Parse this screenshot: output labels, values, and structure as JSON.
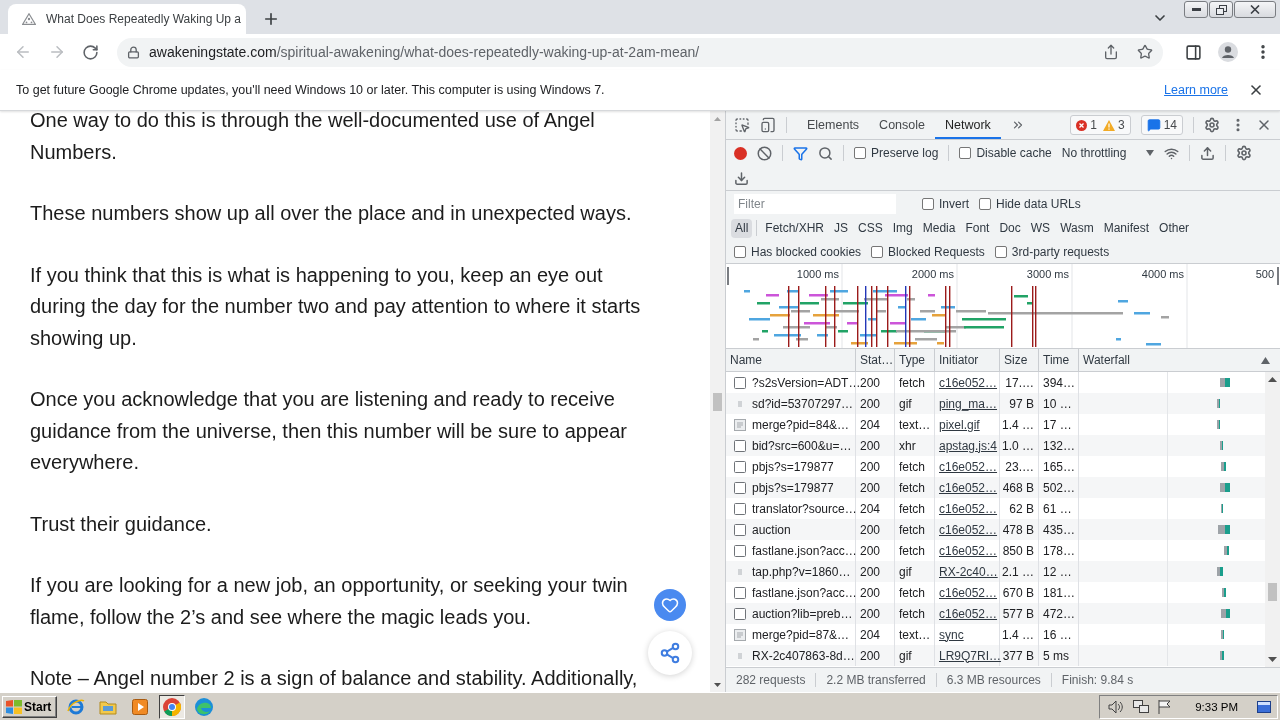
{
  "browser": {
    "tabs": [
      {
        "title": "What Does Repeatedly Waking Up a",
        "selected": true
      }
    ],
    "back": {
      "disabled": true
    },
    "forward": {
      "disabled": true
    },
    "address": {
      "domain": "awakeningstate.com",
      "path": "/spiritual-awakening/what-does-repeatedly-waking-up-at-2am-mean/"
    }
  },
  "infobar": {
    "message": "To get future Google Chrome updates, you'll need Windows 10 or later. This computer is using Windows 7.",
    "link": "Learn more"
  },
  "article": {
    "paragraphs": [
      "One way to do this is through the well-documented use of Angel Numbers.",
      "These numbers show up all over the place and in unexpected ways.",
      "If you think that this is what is happening to you, keep an eye out during the day for the number two and pay attention to where it starts showing up.",
      "Once you acknowledge that you are listening and ready to receive guidance from the universe, then this number will be sure to appear everywhere.",
      "Trust their guidance.",
      "If you are looking for a new job, an opportunity, or seeking your twin flame, follow the 2’s and see where the magic leads you.",
      "Note – Angel number 2 is a sign of balance and stability. Additionally,"
    ]
  },
  "devtools": {
    "tabs": [
      {
        "label": "Elements",
        "selected": false
      },
      {
        "label": "Console",
        "selected": false
      },
      {
        "label": "Network",
        "selected": true
      }
    ],
    "issues": {
      "errors": "1",
      "warnings": "3",
      "messages": "14"
    },
    "recording": true,
    "toolbar_options": [
      {
        "label": "Preserve log",
        "checked": false
      },
      {
        "label": "Disable cache",
        "checked": false
      }
    ],
    "throttling": "No throttling",
    "filter": {
      "placeholder": "Filter"
    },
    "filter_options": [
      {
        "label": "Invert",
        "checked": false
      },
      {
        "label": "Hide data URLs",
        "checked": false
      }
    ],
    "type_filters": [
      {
        "label": "All",
        "selected": true
      },
      {
        "label": "Fetch/XHR",
        "selected": false
      },
      {
        "label": "JS",
        "selected": false
      },
      {
        "label": "CSS",
        "selected": false
      },
      {
        "label": "Img",
        "selected": false
      },
      {
        "label": "Media",
        "selected": false
      },
      {
        "label": "Font",
        "selected": false
      },
      {
        "label": "Doc",
        "selected": false
      },
      {
        "label": "WS",
        "selected": false
      },
      {
        "label": "Wasm",
        "selected": false
      },
      {
        "label": "Manifest",
        "selected": false
      },
      {
        "label": "Other",
        "selected": false
      }
    ],
    "request_options": [
      {
        "label": "Has blocked cookies",
        "checked": false
      },
      {
        "label": "Blocked Requests",
        "checked": false
      },
      {
        "label": "3rd-party requests",
        "checked": false
      }
    ],
    "overview_ticks": [
      "1000 ms",
      "2000 ms",
      "3000 ms",
      "4000 ms",
      "500"
    ],
    "columns": [
      "Name",
      "Stat…",
      "Type",
      "Initiator",
      "Size",
      "Time",
      "Waterfall"
    ],
    "requests": [
      {
        "kind": "file",
        "name": "?s2sVersion=ADT…",
        "status": "200",
        "type": "fetch",
        "initiator": "c16e052…",
        "size": "17.…",
        "time": "394…"
      },
      {
        "kind": "image",
        "name": "sd?id=53707297…",
        "status": "200",
        "type": "gif",
        "initiator": "ping_ma…",
        "size": "97 B",
        "time": "10 …"
      },
      {
        "kind": "document",
        "name": "merge?pid=84&…",
        "status": "204",
        "type": "text…",
        "initiator": "pixel.gif",
        "size": "1.4 …",
        "time": "17 …"
      },
      {
        "kind": "file",
        "name": "bid?src=600&u=…",
        "status": "200",
        "type": "xhr",
        "initiator": "apstag.js:4",
        "size": "1.0 …",
        "time": "132…"
      },
      {
        "kind": "file",
        "name": "pbjs?s=179877",
        "status": "200",
        "type": "fetch",
        "initiator": "c16e052…",
        "size": "23.…",
        "time": "165…"
      },
      {
        "kind": "file",
        "name": "pbjs?s=179877",
        "status": "200",
        "type": "fetch",
        "initiator": "c16e052…",
        "size": "468 B",
        "time": "502…"
      },
      {
        "kind": "file",
        "name": "translator?source…",
        "status": "204",
        "type": "fetch",
        "initiator": "c16e052…",
        "size": "62 B",
        "time": "61 …"
      },
      {
        "kind": "file",
        "name": "auction",
        "status": "200",
        "type": "fetch",
        "initiator": "c16e052…",
        "size": "478 B",
        "time": "435…"
      },
      {
        "kind": "file",
        "name": "fastlane.json?acc…",
        "status": "200",
        "type": "fetch",
        "initiator": "c16e052…",
        "size": "850 B",
        "time": "178…"
      },
      {
        "kind": "image",
        "name": "tap.php?v=1860…",
        "status": "200",
        "type": "gif",
        "initiator": "RX-2c40…",
        "size": "2.1 …",
        "time": "12 …"
      },
      {
        "kind": "file",
        "name": "fastlane.json?acc…",
        "status": "200",
        "type": "fetch",
        "initiator": "c16e052…",
        "size": "670 B",
        "time": "181…"
      },
      {
        "kind": "file",
        "name": "auction?lib=preb…",
        "status": "200",
        "type": "fetch",
        "initiator": "c16e052…",
        "size": "577 B",
        "time": "472…"
      },
      {
        "kind": "document",
        "name": "merge?pid=87&…",
        "status": "204",
        "type": "text…",
        "initiator": "sync",
        "size": "1.4 …",
        "time": "16 …"
      },
      {
        "kind": "image",
        "name": "RX-2c407863-8d…",
        "status": "200",
        "type": "gif",
        "initiator": "LR9Q7RI…",
        "size": "377 B",
        "time": "5 ms"
      }
    ],
    "summary": [
      "282 requests",
      "2.2 MB transferred",
      "6.3 MB resources",
      "Finish: 9.84 s"
    ]
  },
  "taskbar": {
    "start": "Start",
    "apps": [
      {
        "kind": "ie",
        "active": false
      },
      {
        "kind": "folder",
        "active": false
      },
      {
        "kind": "media",
        "active": false
      },
      {
        "kind": "chrome",
        "active": true
      },
      {
        "kind": "edge",
        "active": false
      }
    ],
    "clock": "9:33 PM"
  }
}
